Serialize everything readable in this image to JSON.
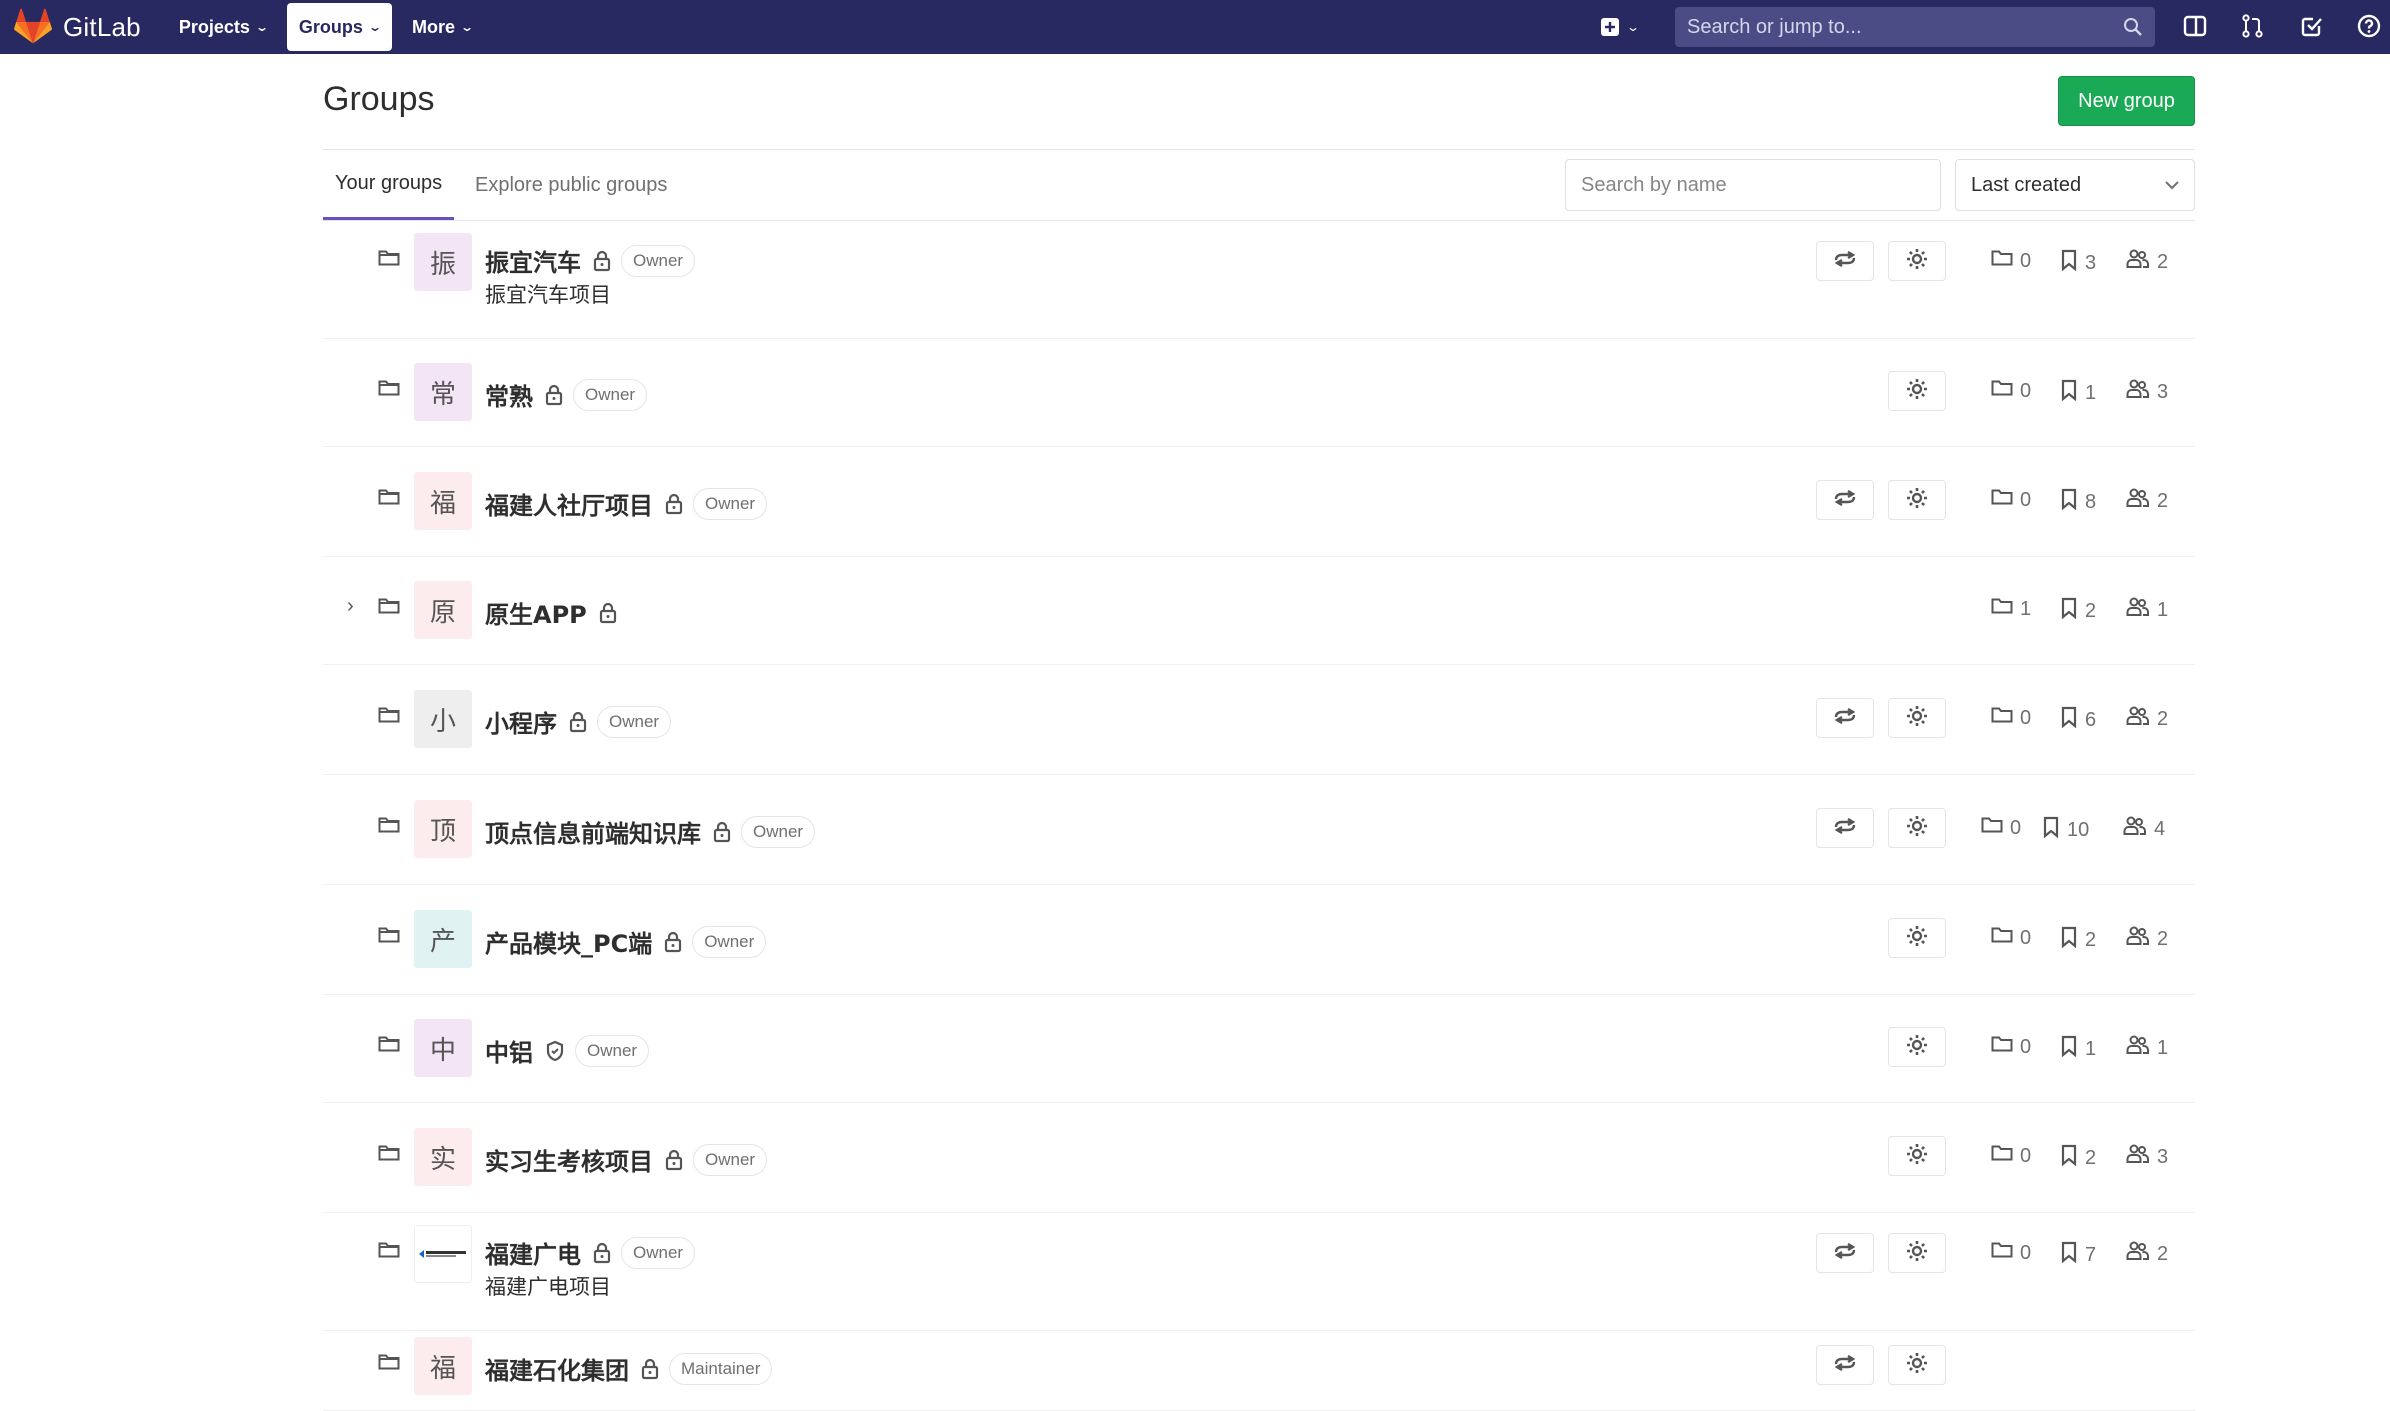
{
  "navbar": {
    "brand": "GitLab",
    "items": [
      {
        "label": "Projects",
        "active": false
      },
      {
        "label": "Groups",
        "active": true
      },
      {
        "label": "More",
        "active": false
      }
    ],
    "search_placeholder": "Search or jump to...",
    "icons": [
      "plus-square-icon",
      "search-icon",
      "sidebar-icon",
      "merge-request-icon",
      "todo-check-icon",
      "help-icon"
    ]
  },
  "page": {
    "title": "Groups",
    "new_group_label": "New group"
  },
  "tabs": [
    {
      "label": "Your groups",
      "active": true
    },
    {
      "label": "Explore public groups",
      "active": false
    }
  ],
  "filter": {
    "search_placeholder": "Search by name",
    "sort_label": "Last created"
  },
  "groups": [
    {
      "avatar": "振",
      "avatar_color": "#f3e5f5",
      "name": "振宜汽车",
      "visibility": "private",
      "badge": "Owner",
      "description": "振宜汽车项目",
      "leave": true,
      "subgroups": "0",
      "projects": "3",
      "members": "2"
    },
    {
      "avatar": "常",
      "avatar_color": "#f3e5f5",
      "name": "常熟",
      "visibility": "private",
      "badge": "Owner",
      "description": "",
      "leave": false,
      "subgroups": "0",
      "projects": "1",
      "members": "3"
    },
    {
      "avatar": "福",
      "avatar_color": "#fdecee",
      "name": "福建人社厅项目",
      "visibility": "private",
      "badge": "Owner",
      "description": "",
      "leave": true,
      "subgroups": "0",
      "projects": "8",
      "members": "2"
    },
    {
      "avatar": "原",
      "avatar_color": "#fdecee",
      "name": "原生APP",
      "visibility": "private",
      "badge": "",
      "description": "",
      "leave": false,
      "expandable": true,
      "subgroups": "1",
      "projects": "2",
      "members": "1"
    },
    {
      "avatar": "小",
      "avatar_color": "#eeeeee",
      "name": "小程序",
      "visibility": "private",
      "badge": "Owner",
      "description": "",
      "leave": true,
      "subgroups": "0",
      "projects": "6",
      "members": "2"
    },
    {
      "avatar": "顶",
      "avatar_color": "#fdecee",
      "name": "顶点信息前端知识库",
      "visibility": "private",
      "badge": "Owner",
      "description": "",
      "leave": true,
      "subgroups": "0",
      "projects": "10",
      "members": "4"
    },
    {
      "avatar": "产",
      "avatar_color": "#e0f2f1",
      "name": "产品模块_PC端",
      "visibility": "private",
      "badge": "Owner",
      "description": "",
      "leave": false,
      "subgroups": "0",
      "projects": "2",
      "members": "2"
    },
    {
      "avatar": "中",
      "avatar_color": "#f3e5f5",
      "name": "中铝",
      "visibility": "internal",
      "badge": "Owner",
      "description": "",
      "leave": false,
      "subgroups": "0",
      "projects": "1",
      "members": "1"
    },
    {
      "avatar": "实",
      "avatar_color": "#fdecee",
      "name": "实习生考核项目",
      "visibility": "private",
      "badge": "Owner",
      "description": "",
      "leave": false,
      "subgroups": "0",
      "projects": "2",
      "members": "3"
    },
    {
      "avatar": "",
      "avatar_color": "#ffffff",
      "avatar_logo": true,
      "name": "福建广电",
      "visibility": "private",
      "badge": "Owner",
      "description": "福建广电项目",
      "leave": true,
      "subgroups": "0",
      "projects": "7",
      "members": "2"
    },
    {
      "avatar": "福",
      "avatar_color": "#fdecee",
      "name": "福建石化集团",
      "visibility": "private",
      "badge": "Maintainer",
      "description": "",
      "leave": true,
      "subgroups": "",
      "projects": "",
      "members": ""
    }
  ]
}
